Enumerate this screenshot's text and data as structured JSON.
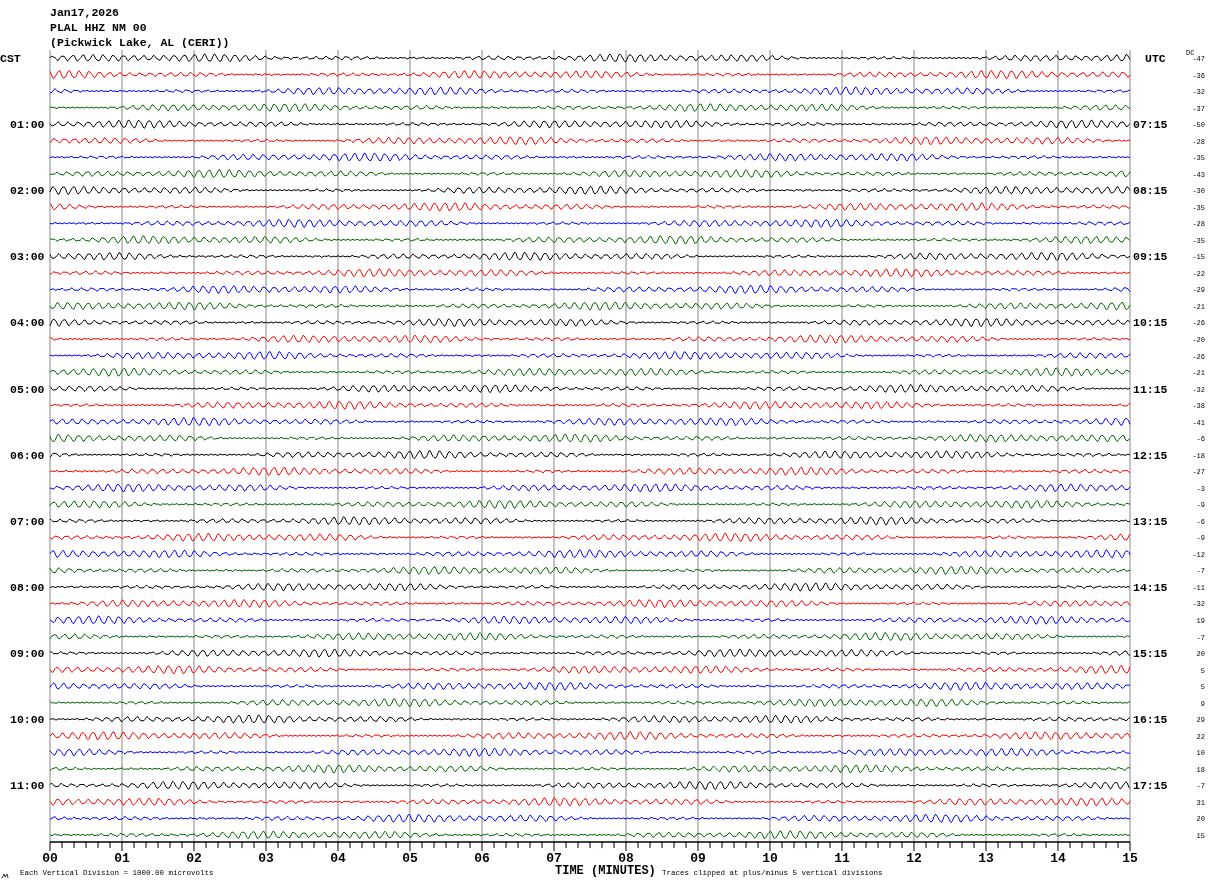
{
  "header": {
    "date": "Jan17,2026",
    "station": "PLAL HHZ NM 00",
    "location": "(Pickwick Lake, AL (CERI))"
  },
  "dc_heading": "DC",
  "hour_rows": [
    {
      "cst": "CST",
      "utc": "UTC"
    },
    {
      "cst": "01:00",
      "utc": "07:15"
    },
    {
      "cst": "02:00",
      "utc": "08:15"
    },
    {
      "cst": "03:00",
      "utc": "09:15"
    },
    {
      "cst": "04:00",
      "utc": "10:15"
    },
    {
      "cst": "05:00",
      "utc": "11:15"
    },
    {
      "cst": "06:00",
      "utc": "12:15"
    },
    {
      "cst": "07:00",
      "utc": "13:15"
    },
    {
      "cst": "08:00",
      "utc": "14:15"
    },
    {
      "cst": "09:00",
      "utc": "15:15"
    },
    {
      "cst": "10:00",
      "utc": "16:15"
    },
    {
      "cst": "11:00",
      "utc": "17:15"
    }
  ],
  "traces": [
    {
      "color": "#000000",
      "dc": "-47"
    },
    {
      "color": "#ff0000",
      "dc": "-36"
    },
    {
      "color": "#0000ff",
      "dc": "-32"
    },
    {
      "color": "#006600",
      "dc": "-37"
    },
    {
      "color": "#000000",
      "dc": "-50"
    },
    {
      "color": "#ff0000",
      "dc": "-28"
    },
    {
      "color": "#0000ff",
      "dc": "-35"
    },
    {
      "color": "#006600",
      "dc": "-43"
    },
    {
      "color": "#000000",
      "dc": "-30"
    },
    {
      "color": "#ff0000",
      "dc": "-35"
    },
    {
      "color": "#0000ff",
      "dc": "-28"
    },
    {
      "color": "#006600",
      "dc": "-35"
    },
    {
      "color": "#000000",
      "dc": "-15"
    },
    {
      "color": "#ff0000",
      "dc": "-22"
    },
    {
      "color": "#0000ff",
      "dc": "-29"
    },
    {
      "color": "#006600",
      "dc": "-21"
    },
    {
      "color": "#000000",
      "dc": "-26"
    },
    {
      "color": "#ff0000",
      "dc": "-20"
    },
    {
      "color": "#0000ff",
      "dc": "-26"
    },
    {
      "color": "#006600",
      "dc": "-21"
    },
    {
      "color": "#000000",
      "dc": "-32"
    },
    {
      "color": "#ff0000",
      "dc": "-38"
    },
    {
      "color": "#0000ff",
      "dc": "-41"
    },
    {
      "color": "#006600",
      "dc": "-6"
    },
    {
      "color": "#000000",
      "dc": "-18"
    },
    {
      "color": "#ff0000",
      "dc": "-27"
    },
    {
      "color": "#0000ff",
      "dc": "-3"
    },
    {
      "color": "#006600",
      "dc": "-9"
    },
    {
      "color": "#000000",
      "dc": "-6"
    },
    {
      "color": "#ff0000",
      "dc": "-9"
    },
    {
      "color": "#0000ff",
      "dc": "-12"
    },
    {
      "color": "#006600",
      "dc": "-7"
    },
    {
      "color": "#000000",
      "dc": "-11"
    },
    {
      "color": "#ff0000",
      "dc": "-32"
    },
    {
      "color": "#0000ff",
      "dc": "19"
    },
    {
      "color": "#006600",
      "dc": "-7"
    },
    {
      "color": "#000000",
      "dc": "20"
    },
    {
      "color": "#ff0000",
      "dc": "5"
    },
    {
      "color": "#0000ff",
      "dc": "5"
    },
    {
      "color": "#006600",
      "dc": "9"
    },
    {
      "color": "#000000",
      "dc": "29"
    },
    {
      "color": "#ff0000",
      "dc": "22"
    },
    {
      "color": "#0000ff",
      "dc": "10"
    },
    {
      "color": "#006600",
      "dc": "18"
    },
    {
      "color": "#000000",
      "dc": "-7"
    },
    {
      "color": "#ff0000",
      "dc": "31"
    },
    {
      "color": "#0000ff",
      "dc": "20"
    },
    {
      "color": "#006600",
      "dc": "15"
    }
  ],
  "time_axis": {
    "ticks": [
      "00",
      "01",
      "02",
      "03",
      "04",
      "05",
      "06",
      "07",
      "08",
      "09",
      "10",
      "11",
      "12",
      "13",
      "14",
      "15"
    ],
    "title": "TIME (MINUTES)"
  },
  "footer": {
    "scale_note": "Each Vertical Division = 1000.00 microvolts",
    "clip_note": "Traces clipped at plus/minus 5 vertical divisions"
  }
}
